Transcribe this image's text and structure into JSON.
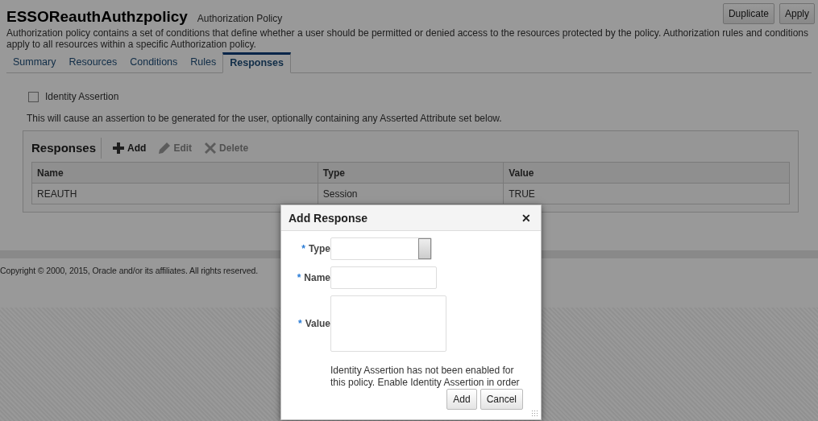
{
  "header": {
    "title": "ESSOReauthAuthzpolicy",
    "subtitle": "Authorization Policy",
    "buttons": [
      {
        "label": "Duplicate"
      },
      {
        "label": "Apply"
      }
    ],
    "description": "Authorization policy contains a set of conditions that define whether a user should be permitted or denied access to the resources protected by the policy. Authorization rules and conditions apply to all resources within a specific Authorization policy."
  },
  "tabs": [
    {
      "label": "Summary",
      "selected": false
    },
    {
      "label": "Resources",
      "selected": false
    },
    {
      "label": "Conditions",
      "selected": false
    },
    {
      "label": "Rules",
      "selected": false
    },
    {
      "label": "Responses",
      "selected": true
    }
  ],
  "identity_assertion": {
    "label": "Identity Assertion",
    "checked": false
  },
  "note": "This will cause an assertion to be generated for the user, optionally containing any Asserted Attribute set below.",
  "responses": {
    "title": "Responses",
    "toolbar": [
      {
        "label": "Add",
        "kind": "plus",
        "disabled": false
      },
      {
        "label": "Edit",
        "kind": "pencil",
        "disabled": true
      },
      {
        "label": "Delete",
        "kind": "cross",
        "disabled": true
      }
    ],
    "columns": [
      "Name",
      "Type",
      "Value"
    ],
    "rows": [
      [
        "REAUTH",
        "Session",
        "TRUE"
      ]
    ]
  },
  "footer": "Copyright © 2000, 2015, Oracle and/or its affiliates. All rights reserved.",
  "dialog": {
    "title": "Add Response",
    "close": "✕",
    "fields": [
      {
        "label": "Type",
        "required": "*",
        "kind": "select"
      },
      {
        "label": "Name",
        "required": "*",
        "kind": "text"
      },
      {
        "label": "Value",
        "required": "*",
        "kind": "textarea"
      }
    ],
    "message": "Identity Assertion has not been enabled for this policy. Enable Identity Assertion in order",
    "buttons": [
      {
        "label": "Add"
      },
      {
        "label": "Cancel"
      }
    ]
  }
}
